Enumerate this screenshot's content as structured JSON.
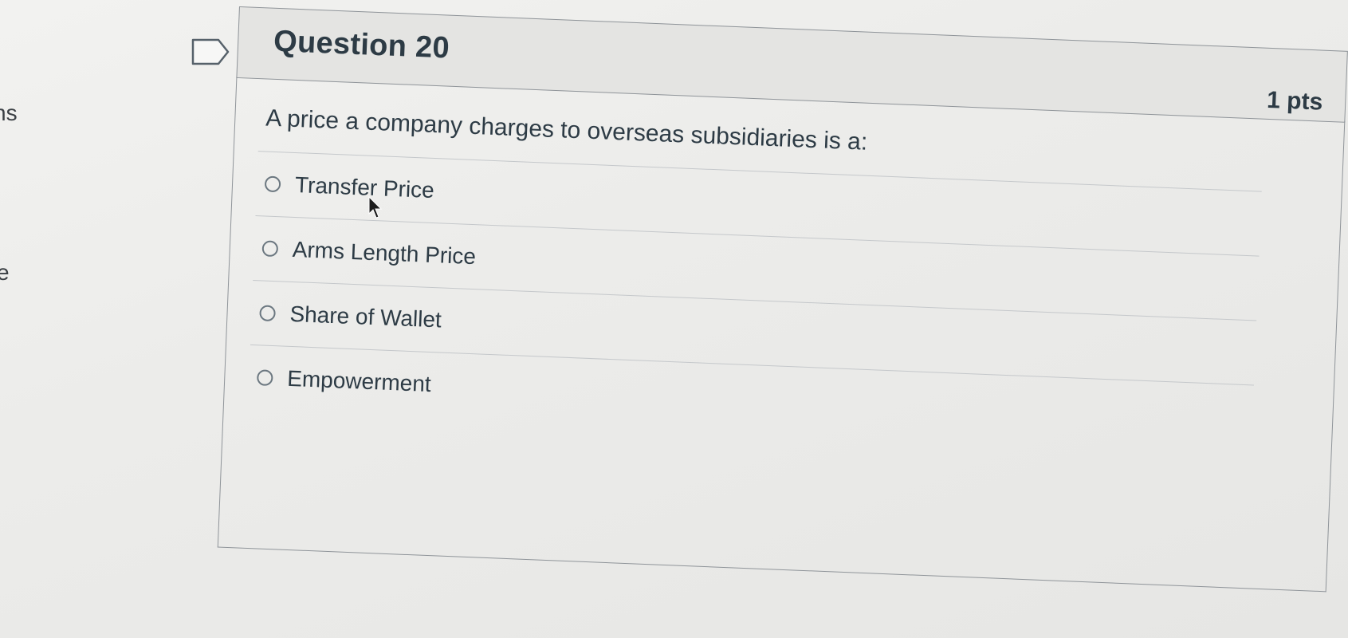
{
  "left_fragments": [
    "ns",
    "e"
  ],
  "question": {
    "title": "Question 20",
    "points": "1 pts",
    "text": "A price a company charges to overseas subsidiaries is a:",
    "answers": [
      "Transfer Price",
      "Arms Length Price",
      "Share of Wallet",
      "Empowerment"
    ]
  },
  "icons": {
    "flag": "flag-question-icon",
    "cursor": "mouse-pointer-icon"
  },
  "colors": {
    "text": "#2d3b45",
    "border": "#8f9499",
    "header_bg": "#e4e4e2"
  }
}
